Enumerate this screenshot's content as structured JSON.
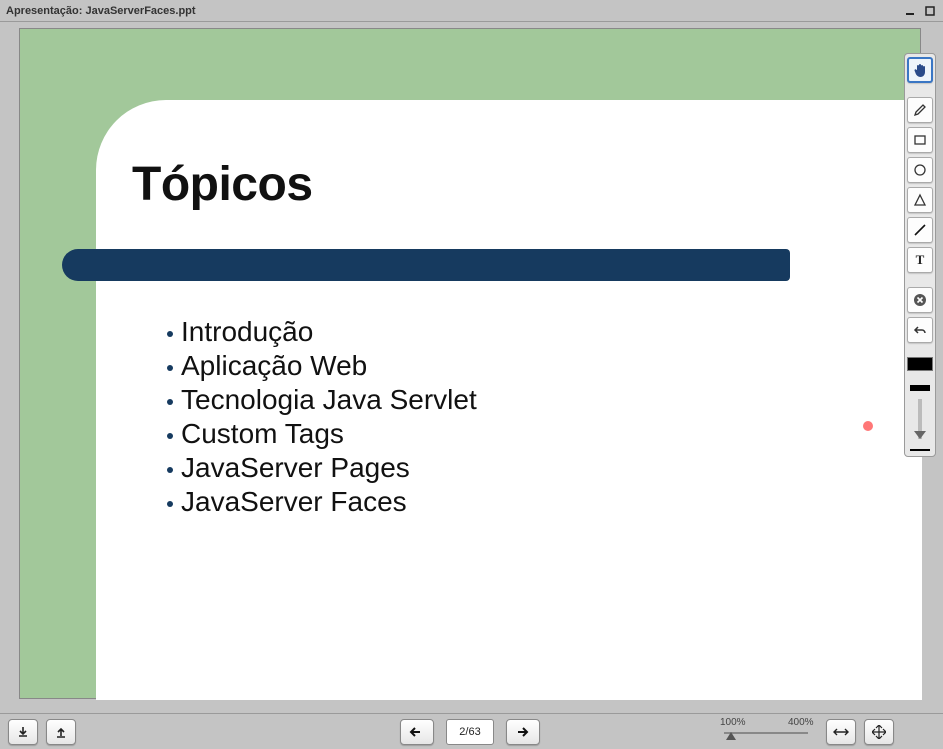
{
  "titlebar": {
    "text": "Apresentação: JavaServerFaces.ppt"
  },
  "slide": {
    "title": "Tópicos",
    "bullets": [
      "Introdução",
      "Aplicação Web",
      "Tecnologia Java Servlet",
      "Custom Tags",
      "JavaServer Pages",
      "JavaServer Faces"
    ]
  },
  "nav": {
    "page_indicator": "2/63"
  },
  "zoom": {
    "min_label": "100%",
    "max_label": "400%"
  },
  "tools": {
    "hand": "hand-tool",
    "pencil": "pencil-tool",
    "rect": "rectangle-tool",
    "circle": "circle-tool",
    "triangle": "triangle-tool",
    "line": "line-tool",
    "text": "text-tool",
    "clear": "clear-tool",
    "undo": "undo-tool"
  },
  "colors": {
    "stroke": "#000000"
  }
}
